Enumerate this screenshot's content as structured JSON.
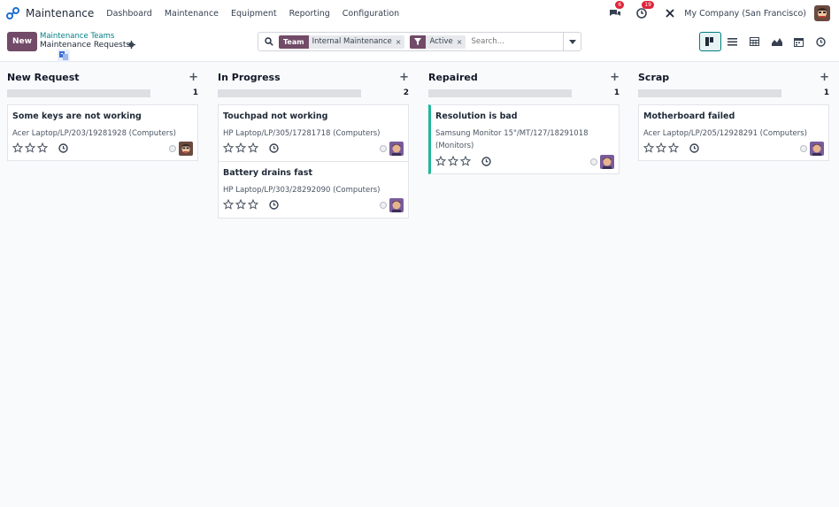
{
  "app": {
    "name": "Maintenance"
  },
  "menu": [
    "Dashboard",
    "Maintenance",
    "Equipment",
    "Reporting",
    "Configuration"
  ],
  "systray": {
    "messages_count": "6",
    "activities_count": "19",
    "company": "My Company (San Francisco)"
  },
  "control": {
    "new_label": "New",
    "breadcrumb_parent": "Maintenance Teams",
    "breadcrumb_current": "Maintenance Requests"
  },
  "search": {
    "facets": [
      {
        "label": "Team",
        "value": "Internal Maintenance"
      },
      {
        "label": "",
        "value": "Active"
      }
    ],
    "placeholder": "Search..."
  },
  "views": [
    "kanban",
    "list",
    "calendar",
    "graph",
    "pivot",
    "activity"
  ],
  "columns": [
    {
      "title": "New Request",
      "count": "1",
      "cards": [
        {
          "title": "Some keys are not working",
          "equipment": "Acer Laptop/LP/203/19281928 (Computers)"
        }
      ]
    },
    {
      "title": "In Progress",
      "count": "2",
      "cards": [
        {
          "title": "Touchpad not working",
          "equipment": "HP Laptop/LP/305/17281718 (Computers)"
        },
        {
          "title": "Battery drains fast",
          "equipment": "HP Laptop/LP/303/28292090 (Computers)"
        }
      ]
    },
    {
      "title": "Repaired",
      "count": "1",
      "cards": [
        {
          "title": "Resolution is bad",
          "equipment": "Samsung Monitor 15\"/MT/127/18291018 (Monitors)"
        }
      ]
    },
    {
      "title": "Scrap",
      "count": "1",
      "cards": [
        {
          "title": "Motherboard failed",
          "equipment": "Acer Laptop/LP/205/12928291 (Computers)"
        }
      ]
    }
  ],
  "colors": {
    "brand": "#714b67",
    "accent": "#017e84",
    "done": "#21b799",
    "badge": "#e0243a"
  }
}
